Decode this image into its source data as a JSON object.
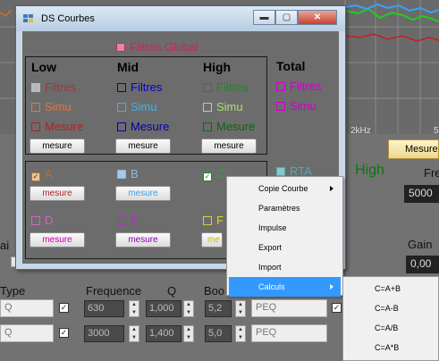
{
  "graph": {
    "freq_label": "2kHz",
    "freq_label_right": "5"
  },
  "background": {
    "mesure_button": "Mesure",
    "high_label": "High",
    "fre_label": "Fre",
    "fre_value": "5000",
    "gain_label": "Gain",
    "gain_value": "0,00",
    "ai_label": "ai",
    "type_label": "Type",
    "frequence_label": "Frequence",
    "q_label": "Q",
    "boo_label": "Boo",
    "q_right_label": "Q",
    "row1": {
      "type": "Q",
      "freq": "630",
      "q": "1,000",
      "boost": "5,2",
      "filter": "PEQ"
    },
    "row2": {
      "type": "Q",
      "freq": "3000",
      "q": "1,400",
      "boost": "5,0",
      "filter": "PEQ"
    }
  },
  "window": {
    "title": "DS Courbes",
    "filtres_global": "Filtres Global",
    "groups": {
      "low": {
        "header": "Low",
        "filtres": "Filtres",
        "simu": "Simu",
        "mesure": "Mesure",
        "button": "mesure"
      },
      "mid": {
        "header": "Mid",
        "filtres": "Filtres",
        "simu": "Simu",
        "mesure": "Mesure",
        "button": "mesure"
      },
      "high": {
        "header": "High",
        "filtres": "Filtres",
        "simu": "Simu",
        "mesure": "Mesure",
        "button": "mesure"
      },
      "total": {
        "header": "Total",
        "filtres": "Filtres",
        "simu": "Simu"
      }
    },
    "curves": {
      "a": {
        "label": "A",
        "button": "mesure",
        "checked": true
      },
      "b": {
        "label": "B",
        "button": "mesure",
        "checked": false
      },
      "c": {
        "label": "C",
        "button": "mesure",
        "checked": true
      },
      "rta": {
        "label": "RTA"
      },
      "d": {
        "label": "D",
        "button": "mesure"
      },
      "e": {
        "label": "E",
        "button": "mesure"
      },
      "f": {
        "label": "F",
        "button": "me"
      }
    },
    "colors": {
      "low": "#b22222",
      "low_simu": "#e8743a",
      "mid": "#0000cc",
      "mid_simu": "#40b0e8",
      "high": "#1a8a1a",
      "high_simu": "#a8e070",
      "total": "#cc00cc",
      "filtres_global": "#cc2266"
    }
  },
  "context_menu": {
    "items": [
      "Copie Courbe",
      "Paramètres",
      "Impulse",
      "Export",
      "Import",
      "Calculs"
    ],
    "selected": "Calculs",
    "submenu": [
      "C=A+B",
      "C=A-B",
      "C=A/B",
      "C=A*B"
    ]
  }
}
